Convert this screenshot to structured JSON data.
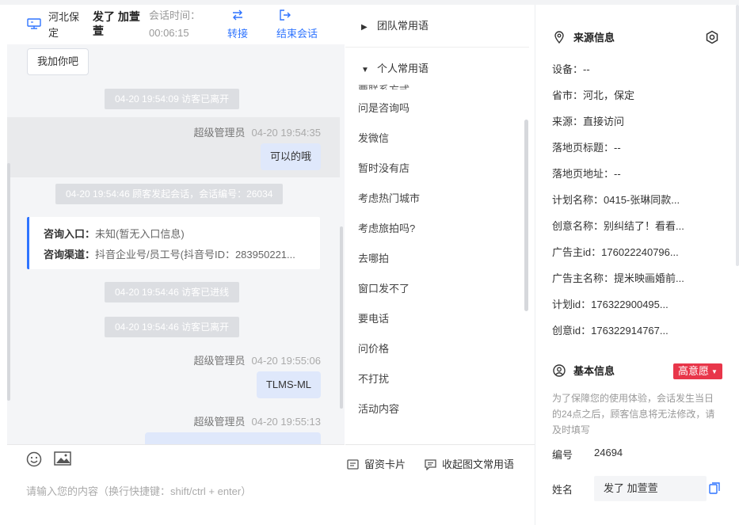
{
  "header": {
    "visitor_location": "河北保定",
    "visitor_name": "发了 加萱萱",
    "session_time_label": "会话时间：",
    "session_time": "00:06:15",
    "transfer_label": "转接",
    "end_label": "结束会话"
  },
  "messages": {
    "visitor_msg": "我加你吧",
    "sys_leave_1": "04-20 19:54:09 访客已离开",
    "agent_1_name": "超级管理员",
    "agent_1_time": "04-20 19:54:35",
    "agent_1_text": "可以的哦",
    "sys_start": "04-20 19:54:46 顾客发起会话，会话编号：26034",
    "card_entry_label": "咨询入口：",
    "card_entry_value": "未知(暂无入口信息)",
    "card_channel_label": "咨询渠道：",
    "card_channel_value": "抖音企业号/员工号(抖音号ID：283950221...",
    "sys_enter": "04-20 19:54:46 访客已进线",
    "sys_leave_2": "04-20 19:54:46 访客已离开",
    "agent_2_name": "超级管理员",
    "agent_2_time": "04-20 19:55:06",
    "agent_2_text": "TLMS-ML",
    "agent_3_name": "超级管理员",
    "agent_3_time": "04-20 19:55:13"
  },
  "input": {
    "placeholder": "请输入您的内容（换行快捷键：shift/ctrl + enter）"
  },
  "phrases": {
    "team_title": "团队常用语",
    "personal_title": "个人常用语",
    "clipped_item": "要联系方式",
    "items": [
      "问是咨询吗",
      "发微信",
      "暂时没有店",
      "考虑热门城市",
      "考虑旅拍吗?",
      "去哪拍",
      "窗口发不了",
      "要电话",
      "问价格",
      "不打扰",
      "活动内容"
    ],
    "card_tool": "留资卡片",
    "collect_tool": "收起图文常用语"
  },
  "source_info": {
    "title": "来源信息",
    "device_label": "设备：",
    "device_value": "--",
    "province_label": "省市：",
    "province_value": "河北，保定",
    "source_label": "来源：",
    "source_value": "直接访问",
    "landing_title_label": "落地页标题：",
    "landing_title_value": "--",
    "landing_url_label": "落地页地址：",
    "landing_url_value": "--",
    "plan_name_label": "计划名称：",
    "plan_name_value": "0415-张琳同款...",
    "creative_name_label": "创意名称：",
    "creative_name_value": "别纠结了！看看...",
    "advertiser_id_label": "广告主id：",
    "advertiser_id_value": "176022240796...",
    "advertiser_name_label": "广告主名称：",
    "advertiser_name_value": "提米映画婚前...",
    "plan_id_label": "计划id：",
    "plan_id_value": "176322900495...",
    "creative_id_label": "创意id：",
    "creative_id_value": "176322914767..."
  },
  "basic_info": {
    "title": "基本信息",
    "intent_badge": "高意愿",
    "notice": "为了保障您的使用体验，会话发生当日的24点之后，顾客信息将无法修改，请及时填写",
    "id_label": "编号",
    "id_value": "24694",
    "name_label": "姓名",
    "name_value": "发了 加萱萱"
  },
  "colors": {
    "accent": "#2f74ff",
    "agent_bubble": "#dfe8fb",
    "system_msg": "#dcdee2",
    "badge_red": "#e8364a"
  }
}
